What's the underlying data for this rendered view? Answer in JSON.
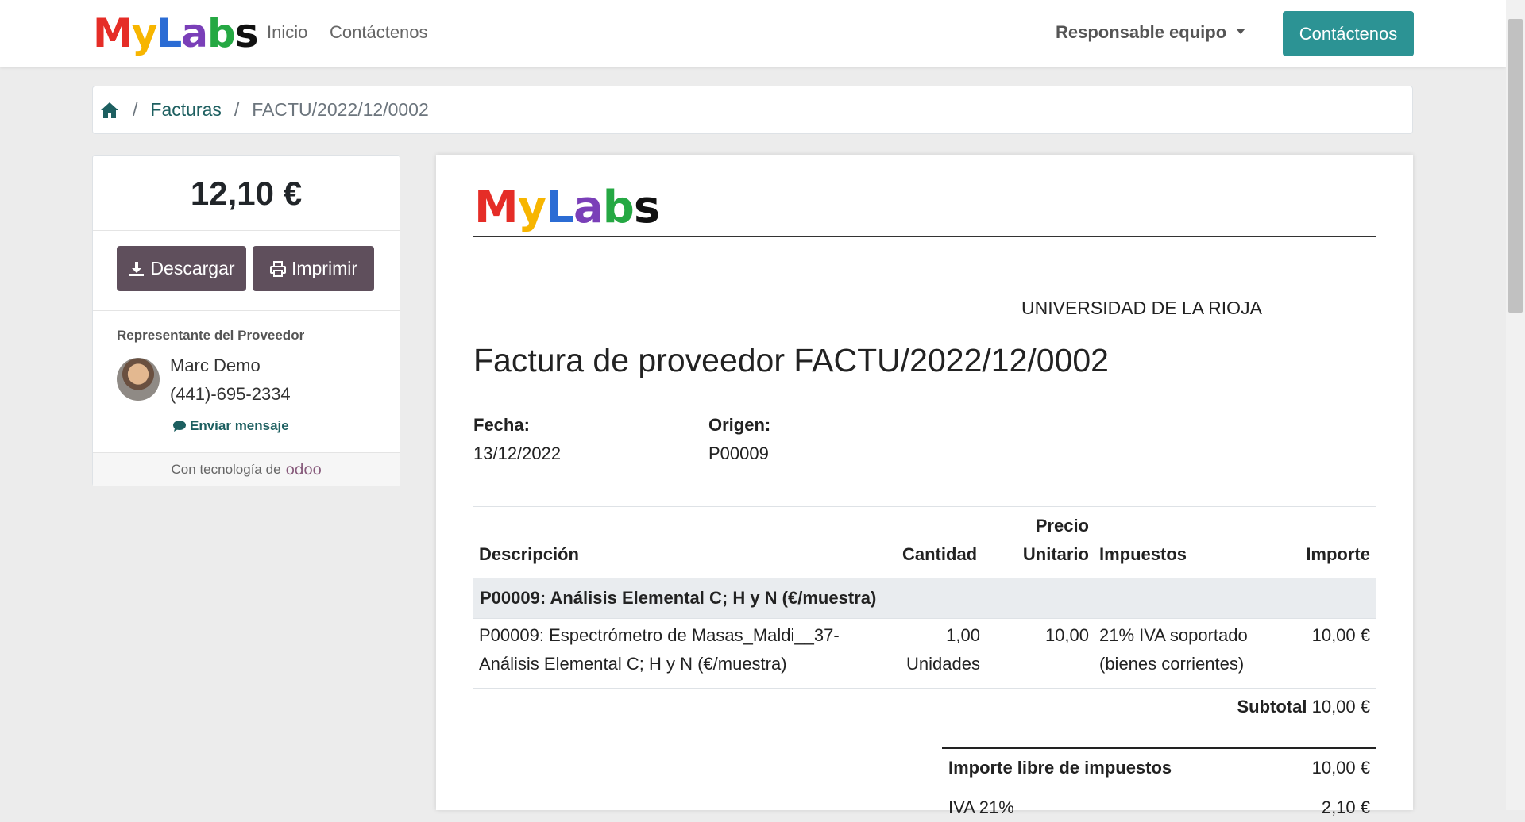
{
  "navbar": {
    "brand": [
      "M",
      "y",
      "L",
      "a",
      "b",
      "s"
    ],
    "links": {
      "home": "Inicio",
      "contact": "Contáctenos"
    },
    "user_menu": "Responsable equipo",
    "cta_button": "Contáctenos"
  },
  "breadcrumb": {
    "separator": "/",
    "invoices": "Facturas",
    "current": "FACTU/2022/12/0002"
  },
  "sidebar": {
    "amount": "12,10 €",
    "download_label": "Descargar",
    "print_label": "Imprimir",
    "rep_title": "Representante del Proveedor",
    "rep_name": "Marc Demo",
    "rep_phone": "(441)-695-2334",
    "send_message": "Enviar mensaje",
    "powered_by": "Con tecnología de",
    "powered_brand": "odoo"
  },
  "document": {
    "customer": "UNIVERSIDAD DE LA RIOJA",
    "title": "Factura de proveedor FACTU/2022/12/0002",
    "date_label": "Fecha:",
    "date_value": "13/12/2022",
    "origin_label": "Origen:",
    "origin_value": "P00009",
    "table": {
      "headers": {
        "description": "Descripción",
        "quantity": "Cantidad",
        "unit_price_1": "Precio",
        "unit_price_2": "Unitario",
        "taxes": "Impuestos",
        "amount": "Importe"
      },
      "section": "P00009: Análisis Elemental C; H y N (€/muestra)",
      "line": {
        "desc_1": "P00009: Espectrómetro de Masas_Maldi__37-",
        "desc_2": "Análisis Elemental C; H y N (€/muestra)",
        "qty": "1,00",
        "uom": "Unidades",
        "price": "10,00",
        "tax_1": "21% IVA soportado",
        "tax_2": "(bienes corrientes)",
        "amount": "10,00 €"
      },
      "subtotal_label": "Subtotal",
      "subtotal_value": "10,00 €"
    },
    "totals": {
      "untaxed_label": "Importe libre de impuestos",
      "untaxed_value": "10,00 €",
      "tax_label": "IVA 21%",
      "tax_value": "2,10 €"
    }
  },
  "colors": {
    "accent": "#2c9394",
    "button_dark": "#5f4f5c",
    "link": "#1d5f60",
    "logo": [
      "#e52d27",
      "#f7b500",
      "#2b6cd4",
      "#7a3fb8",
      "#25a843",
      "#111111"
    ]
  }
}
